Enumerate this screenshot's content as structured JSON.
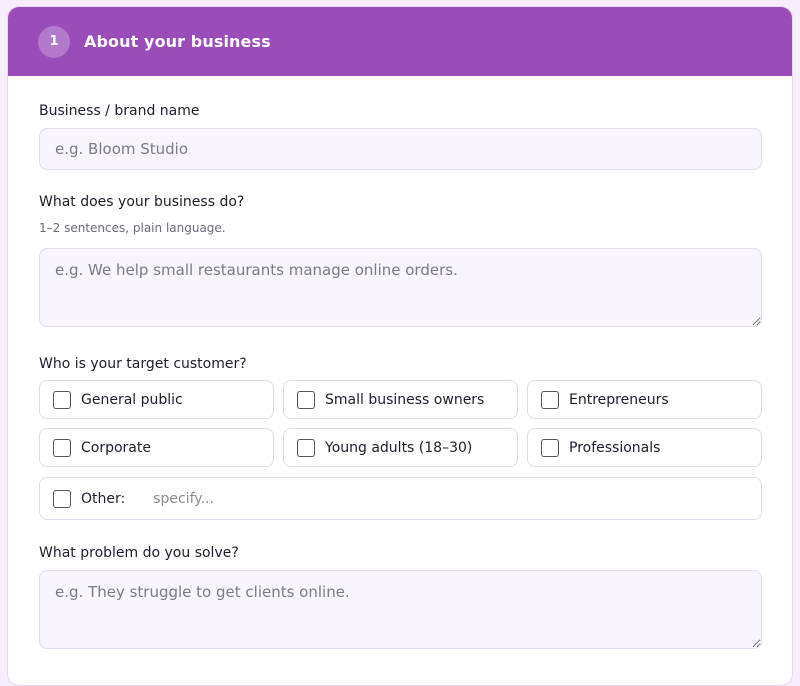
{
  "section": {
    "step_number": "1",
    "title": "About your business"
  },
  "fields": {
    "brand_name": {
      "label": "Business / brand name",
      "placeholder": "e.g. Bloom Studio",
      "value": ""
    },
    "business_description": {
      "label": "What does your business do?",
      "hint": "1–2 sentences, plain language.",
      "placeholder": "e.g. We help small restaurants manage online orders."
    },
    "target_customer": {
      "label": "Who is your target customer?",
      "options": [
        {
          "label": "General public",
          "checked": false
        },
        {
          "label": "Small business owners",
          "checked": false
        },
        {
          "label": "Entrepreneurs",
          "checked": false
        },
        {
          "label": "Corporate",
          "checked": false
        },
        {
          "label": "Young adults (18–30)",
          "checked": false
        },
        {
          "label": "Professionals",
          "checked": false
        }
      ],
      "other_label": "Other:",
      "other_placeholder": "specify..."
    },
    "problem_solved": {
      "label": "What problem do you solve?",
      "placeholder": "e.g. They struggle to get clients online."
    }
  },
  "colors": {
    "header_bg": "#9a4cb8",
    "page_bg": "#f5eefa",
    "input_bg": "#f8f6fc",
    "border": "#e2dcea"
  }
}
